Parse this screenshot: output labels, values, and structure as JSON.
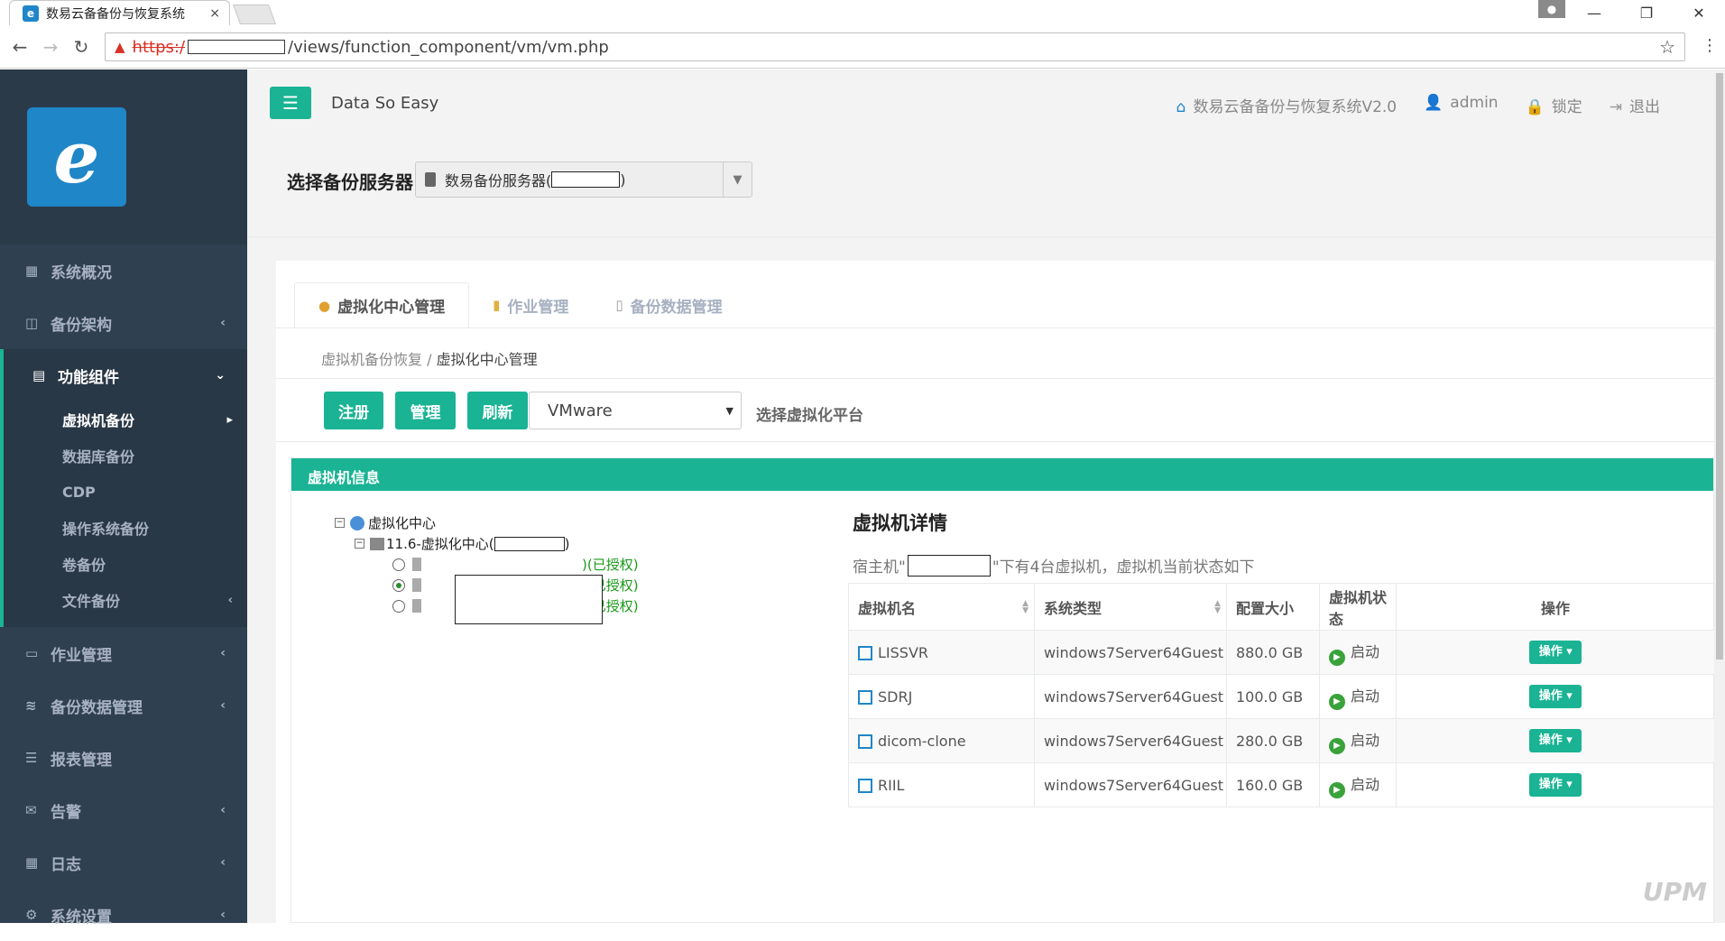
{
  "browser": {
    "tab_title": "数易云备备份与恢复系统",
    "tab_close": "×",
    "url_scheme": "https:/",
    "url_path": "/views/function_component/vm/vm.php",
    "window_min": "—",
    "window_restore": "❐",
    "window_close": "✕"
  },
  "sidebar": {
    "items": [
      {
        "label": "系统概况",
        "icon": "grid-icon"
      },
      {
        "label": "备份架构",
        "icon": "columns-icon",
        "chevron": "‹"
      },
      {
        "label": "功能组件",
        "icon": "chart-icon",
        "chevron": "›"
      },
      {
        "label": "作业管理",
        "icon": "monitor-icon",
        "chevron": "‹"
      },
      {
        "label": "备份数据管理",
        "icon": "database-icon",
        "chevron": "‹"
      },
      {
        "label": "报表管理",
        "icon": "list-icon"
      },
      {
        "label": "告警",
        "icon": "envelope-icon",
        "chevron": "‹"
      },
      {
        "label": "日志",
        "icon": "table-icon",
        "chevron": "‹"
      },
      {
        "label": "系统设置",
        "icon": "gear-icon",
        "chevron": "‹"
      }
    ],
    "sub_items": [
      {
        "label": "虚拟机备份",
        "chevron": "▸"
      },
      {
        "label": "数据库备份"
      },
      {
        "label": "CDP"
      },
      {
        "label": "操作系统备份"
      },
      {
        "label": "卷备份"
      },
      {
        "label": "文件备份",
        "chevron": "‹"
      }
    ]
  },
  "topnav": {
    "brand": "Data So Easy",
    "system_name": "数易云备备份与恢复系统V2.0",
    "user": "admin",
    "lock": "锁定",
    "logout": "退出"
  },
  "server": {
    "label": "选择备份服务器",
    "selected_prefix": "数易备份服务器(",
    "selected_suffix": ")"
  },
  "tabs": [
    "虚拟化中心管理",
    "作业管理",
    "备份数据管理"
  ],
  "breadcrumb": {
    "parent": "虚拟机备份恢复 /",
    "current": "虚拟化中心管理"
  },
  "toolbar": {
    "register": "注册",
    "manage": "管理",
    "refresh": "刷新",
    "platform_value": "VMware",
    "platform_label": "选择虚拟化平台"
  },
  "vm_panel": {
    "header": "虚拟机信息",
    "tree": {
      "root": "虚拟化中心",
      "center_prefix": "11.6-虚拟化中心(",
      "center_suffix": ")",
      "vms": [
        {
          "auth": ")(已授权)",
          "selected": false
        },
        {
          "auth": ")(已授权)",
          "selected": true
        },
        {
          "auth": ")(已授权)",
          "selected": false
        }
      ]
    },
    "detail_title": "虚拟机详情",
    "detail_desc_prefix": "宿主机\"",
    "detail_desc_suffix": "\"下有4台虚拟机，虚拟机当前状态如下",
    "columns": [
      "虚拟机名",
      "系统类型",
      "配置大小",
      "虚拟机状态",
      "操作"
    ],
    "rows": [
      {
        "name": "LISSVR",
        "os": "windows7Server64Guest",
        "size": "880.0 GB",
        "state": "启动",
        "op": "操作 ▾"
      },
      {
        "name": "SDRJ",
        "os": "windows7Server64Guest",
        "size": "100.0 GB",
        "state": "启动",
        "op": "操作 ▾"
      },
      {
        "name": "dicom-clone",
        "os": "windows7Server64Guest",
        "size": "280.0 GB",
        "state": "启动",
        "op": "操作 ▾"
      },
      {
        "name": "RIIL",
        "os": "windows7Server64Guest",
        "size": "160.0 GB",
        "state": "启动",
        "op": "操作 ▾"
      }
    ]
  },
  "colors": {
    "accent": "#1ab394",
    "sidebar": "#2f4050",
    "brand_blue": "#1f86c8"
  }
}
